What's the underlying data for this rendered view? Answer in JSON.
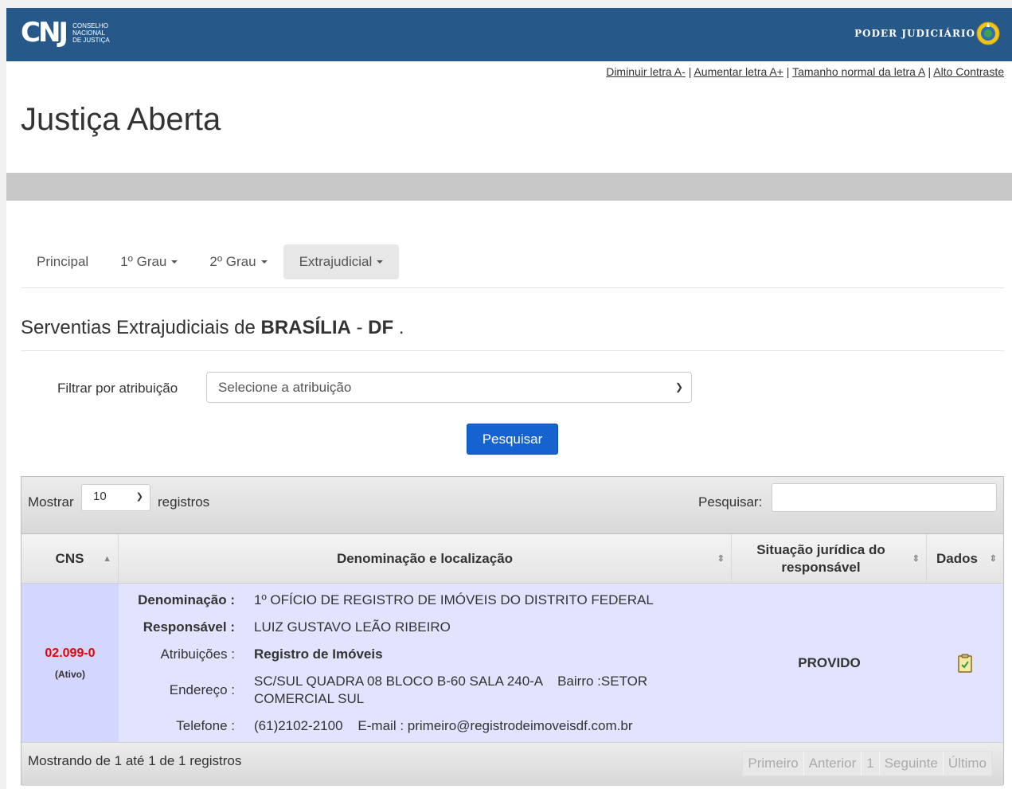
{
  "header": {
    "logo_mark": "CNJ",
    "logo_lines": [
      "CONSELHO",
      "NACIONAL",
      "DE JUSTIÇA"
    ],
    "right_text": "PODER JUDICIÁRIO"
  },
  "accessibility": {
    "decrease": "Diminuir letra A-",
    "increase": "Aumentar letra A+",
    "normal": "Tamanho normal da letra A",
    "contrast": "Alto Contraste"
  },
  "page_title": "Justiça Aberta",
  "nav": {
    "items": [
      {
        "label": "Principal"
      },
      {
        "label": "1º Grau"
      },
      {
        "label": "2º Grau"
      },
      {
        "label": "Extrajudicial"
      }
    ]
  },
  "subtitle": {
    "prefix": "Serventias Extrajudiciais de ",
    "city": "BRASÍLIA",
    "sep": " - ",
    "state": "DF",
    "suffix": " ."
  },
  "filter": {
    "label": "Filtrar por atribuição",
    "selected": "Selecione a atribuição",
    "button": "Pesquisar"
  },
  "table": {
    "show_label": "Mostrar",
    "show_value": "10",
    "records_label": "registros",
    "search_label": "Pesquisar:",
    "headers": {
      "cns": "CNS",
      "den": "Denominação e localização",
      "sit": "Situação jurídica do responsável",
      "dad": "Dados"
    },
    "rows": [
      {
        "cns": "02.099-0",
        "status": "(Ativo)",
        "den_label": "Denominação :",
        "den": "1º OFÍCIO DE REGISTRO DE IMÓVEIS DO DISTRITO FEDERAL",
        "resp_label": "Responsável :",
        "resp": "LUIZ GUSTAVO LEÃO RIBEIRO",
        "atr_label": "Atribuições :",
        "atr": "Registro de Imóveis",
        "end_label": "Endereço :",
        "end": "SC/SUL QUADRA 08 BLOCO B-60 SALA 240-A    Bairro :SETOR COMERCIAL SUL",
        "tel_label": "Telefone :",
        "tel": "(61)2102-2100    E-mail : primeiro@registrodeimoveisdf.com.br",
        "situacao": "PROVIDO"
      }
    ],
    "footer_info": "Mostrando de 1 até 1 de 1 registros",
    "pager": [
      "Primeiro",
      "Anterior",
      "1",
      "Seguinte",
      "Último"
    ]
  },
  "colors": {
    "topbar": "#26598a",
    "button": "#1463d0",
    "row_bg": "#e2e4ff",
    "cns_code": "#ee0000"
  }
}
